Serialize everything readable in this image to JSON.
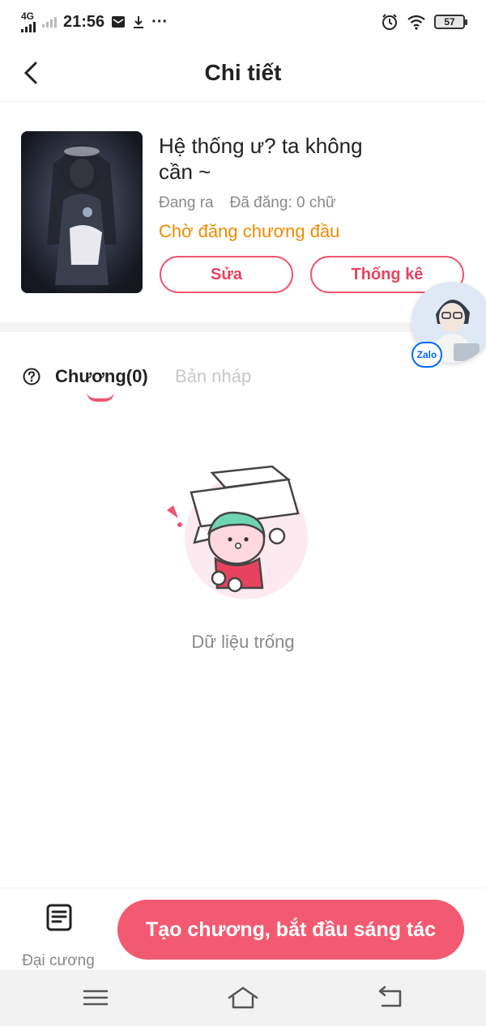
{
  "status_bar": {
    "network": "4G",
    "time": "21:56",
    "more": "···",
    "battery": "57"
  },
  "header": {
    "title": "Chi tiết"
  },
  "book": {
    "title": "Hệ thống ư? ta không cần ~",
    "state": "Đang ra",
    "published": "Đã đăng: 0 chữ",
    "status": "Chờ đăng chương đầu",
    "edit_label": "Sửa",
    "stats_label": "Thống kê"
  },
  "zalo": {
    "badge": "Zalo"
  },
  "tabs": {
    "chapters": "Chương(0)",
    "drafts": "Bản nháp"
  },
  "empty": {
    "text": "Dữ liệu trống"
  },
  "bottom": {
    "outline_label": "Đại cương",
    "create_label": "Tạo chương, bắt đầu sáng tác"
  },
  "colors": {
    "accent": "#f25a72",
    "status_orange": "#f08a00"
  }
}
